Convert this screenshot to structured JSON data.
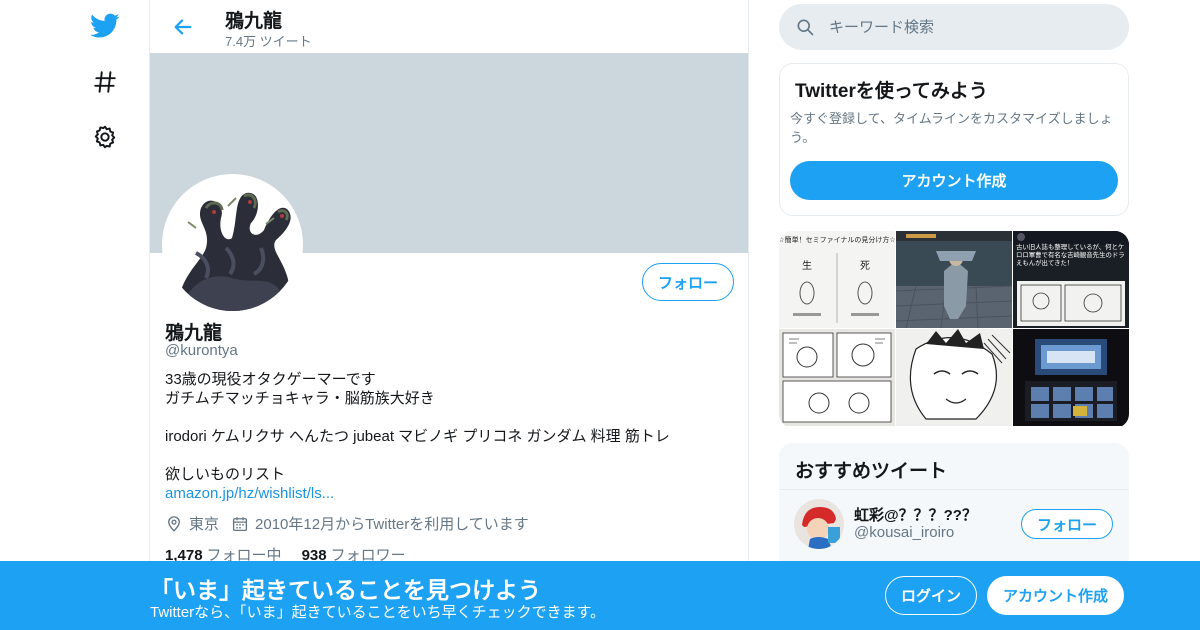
{
  "nav": {
    "icons": [
      "twitter-logo-icon",
      "hashtag-icon",
      "settings-gear-icon"
    ]
  },
  "header": {
    "name": "鴉九龍",
    "tweet_count": "7.4万 ツイート"
  },
  "profile": {
    "follow_label": "フォロー",
    "name": "鴉九龍",
    "handle": "@kurontya",
    "bio_lines": [
      "33歳の現役オタクゲーマーです",
      "ガチムチマッチョキャラ・脳筋族大好き",
      "",
      "irodori ケムリクサ へんたつ jubeat マビノギ プリコネ ガンダム 料理 筋トレ",
      "",
      "欲しいものリスト"
    ],
    "bio_link": "amazon.jp/hz/wishlist/ls...",
    "location": "東京",
    "joined": "2010年12月からTwitterを利用しています",
    "following_count": "1,478",
    "following_label": "フォロー中",
    "followers_count": "938",
    "followers_label": "フォロワー"
  },
  "search": {
    "placeholder": "キーワード検索"
  },
  "signup_card": {
    "title": "Twitterを使ってみよう",
    "description": "今すぐ登録して、タイムラインをカスタマイズしましょう。",
    "button": "アカウント作成"
  },
  "media": {
    "tiles": [
      {
        "heading": "☆簡単！セミファイナルの見分け方☆",
        "label_a": "生",
        "label_b": "死"
      },
      {
        "caption": ""
      },
      {
        "text": "古い旧人誌も整理しているが、何とケロロ軍曹で有名な吉崎観音先生のドラえもんが出てきた！"
      },
      {
        "caption": ""
      },
      {
        "caption": ""
      },
      {
        "caption": ""
      }
    ]
  },
  "recommended": {
    "title": "おすすめツイート",
    "user_name": "虹彩@？？？??？",
    "user_handle": "@kousai_iroiro",
    "follow_label": "フォロー"
  },
  "bottom_bar": {
    "headline": "「いま」起きていることを見つけよう",
    "subtext": "Twitterなら、「いま」起きていることをいち早くチェックできます。",
    "login": "ログイン",
    "signup": "アカウント作成"
  },
  "colors": {
    "accent": "#1da1f2",
    "banner": "#ccd6dd",
    "muted": "#657786"
  }
}
